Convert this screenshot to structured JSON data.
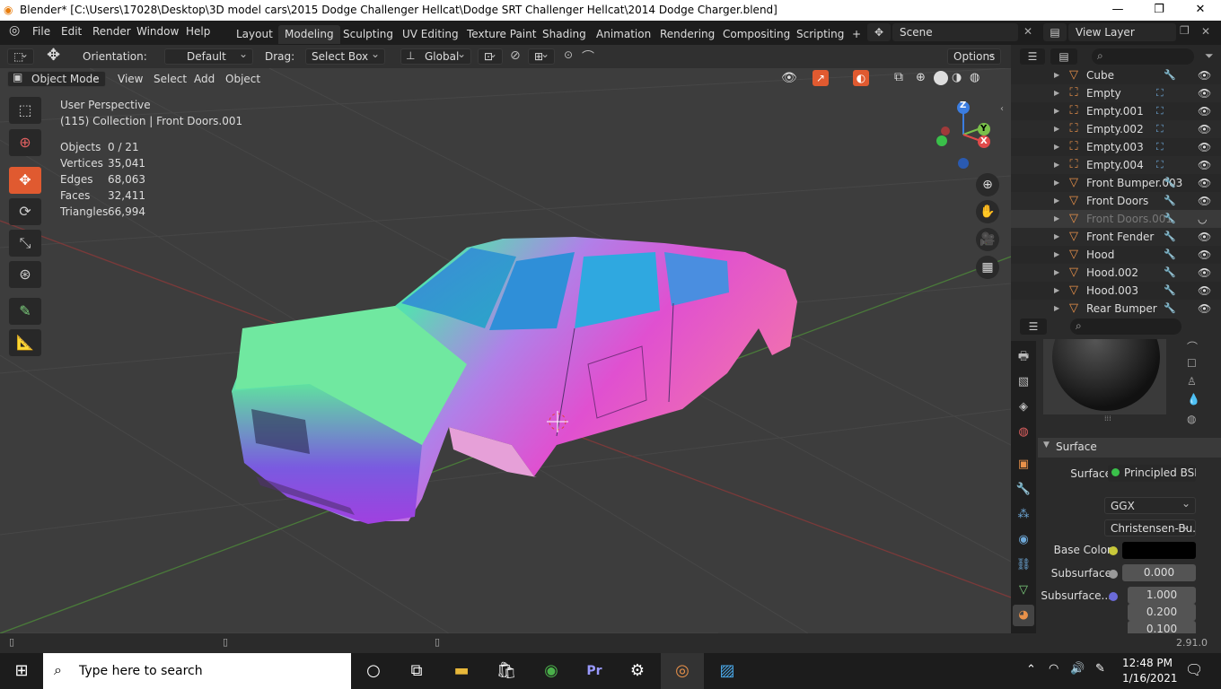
{
  "window": {
    "title": "Blender* [C:\\Users\\17028\\Desktop\\3D model cars\\2015 Dodge Challenger Hellcat\\Dodge SRT Challenger Hellcat\\2014 Dodge Charger.blend]",
    "minimize": "—",
    "maximize": "❐",
    "close": "✕"
  },
  "menu": [
    "File",
    "Edit",
    "Render",
    "Window",
    "Help"
  ],
  "workspaces": [
    "Layout",
    "Modeling",
    "Sculpting",
    "UV Editing",
    "Texture Paint",
    "Shading",
    "Animation",
    "Rendering",
    "Compositing",
    "Scripting"
  ],
  "scene": {
    "label": "Scene",
    "view_layer": "View Layer"
  },
  "toolheader": {
    "orientation_label": "Orientation:",
    "orientation_value": "Default",
    "drag_label": "Drag:",
    "drag_value": "Select Box",
    "transform": "Global",
    "options": "Options"
  },
  "viewport_header": {
    "mode": "Object Mode",
    "menus": [
      "View",
      "Select",
      "Add",
      "Object"
    ]
  },
  "overlay": {
    "perspective": "User Perspective",
    "collection": "(115) Collection | Front Doors.001",
    "stats": [
      {
        "label": "Objects",
        "value": "0 / 21"
      },
      {
        "label": "Vertices",
        "value": "35,041"
      },
      {
        "label": "Edges",
        "value": "68,063"
      },
      {
        "label": "Faces",
        "value": "32,411"
      },
      {
        "label": "Triangles",
        "value": "66,994"
      }
    ]
  },
  "gizmo": {
    "z": "Z",
    "y": "Y",
    "x": "X"
  },
  "outliner": [
    {
      "name": "Cube",
      "icon": "mesh-icon",
      "hidden": false
    },
    {
      "name": "Empty",
      "icon": "empty-icon",
      "hidden": false
    },
    {
      "name": "Empty.001",
      "icon": "empty-icon",
      "hidden": false
    },
    {
      "name": "Empty.002",
      "icon": "empty-icon",
      "hidden": false
    },
    {
      "name": "Empty.003",
      "icon": "empty-icon",
      "hidden": false
    },
    {
      "name": "Empty.004",
      "icon": "empty-icon",
      "hidden": false
    },
    {
      "name": "Front Bumper.003",
      "icon": "mesh-icon",
      "hidden": false
    },
    {
      "name": "Front Doors",
      "icon": "mesh-icon",
      "hidden": false
    },
    {
      "name": "Front Doors.001",
      "icon": "mesh-icon",
      "hidden": true
    },
    {
      "name": "Front Fender",
      "icon": "mesh-icon",
      "hidden": false
    },
    {
      "name": "Hood",
      "icon": "mesh-icon",
      "hidden": false
    },
    {
      "name": "Hood.002",
      "icon": "mesh-icon",
      "hidden": false
    },
    {
      "name": "Hood.003",
      "icon": "mesh-icon",
      "hidden": false
    },
    {
      "name": "Rear Bumper",
      "icon": "mesh-icon",
      "hidden": false
    }
  ],
  "properties": {
    "panel": "Surface",
    "surface_label": "Surface",
    "surface_value": "Principled BSDF",
    "distribution": "GGX",
    "subsurface_method": "Christensen-Bu...",
    "base_color_label": "Base Color",
    "subsurface_label": "Subsurface",
    "subsurface_value": "0.000",
    "subsurface_radius_label": "Subsurface...",
    "radius": [
      "1.000",
      "0.200",
      "0.100"
    ]
  },
  "status": {
    "version": "2.91.0"
  },
  "taskbar": {
    "search_placeholder": "Type here to search",
    "time": "12:48 PM",
    "date": "1/16/2021"
  }
}
